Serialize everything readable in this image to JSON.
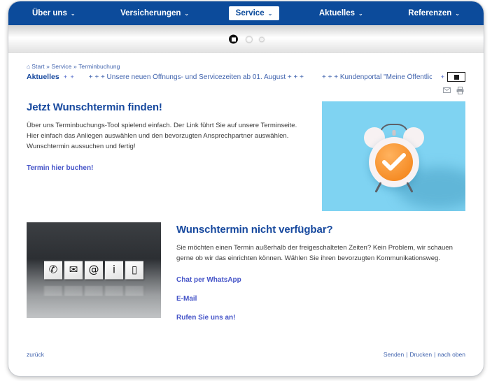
{
  "nav": {
    "items": [
      {
        "label": "Über uns",
        "active": false,
        "caret": "⌄"
      },
      {
        "label": "Versicherungen",
        "active": false,
        "caret": "⌄"
      },
      {
        "label": "Service",
        "active": true,
        "caret": "⌄"
      },
      {
        "label": "Aktuelles",
        "active": false,
        "caret": "⌄"
      },
      {
        "label": "Referenzen",
        "active": false,
        "caret": "⌄"
      }
    ]
  },
  "hero": {
    "slide_count": 3,
    "active_slide": 1
  },
  "breadcrumb": {
    "home_icon": "⌂",
    "text": "Start » Service » Terminbuchung"
  },
  "ticker": {
    "label": "Aktuelles",
    "plus": "+ +",
    "items": [
      "+ + + Unsere neuen Öffnungs- und Servicezeiten ab 01. August + + +",
      "+ + + Kundenportal \"Meine Öffentliche\" + + +"
    ],
    "trailing_plus": "+",
    "pause_control": "pause-button"
  },
  "tools": {
    "send_icon": "send-icon",
    "print_icon": "print-icon"
  },
  "section1": {
    "heading": "Jetzt Wunschtermin finden!",
    "body": "Über uns Terminbuchungs-Tool spielend einfach. Der Link führt Sie auf unsere Terminseite. Hier einfach das Anliegen auswählen und den bevorzugten Ansprechpartner auswählen. Wunschtermin aussuchen und fertig!",
    "link": "Termin hier buchen!",
    "image_alt": "alarm-clock-with-checkmark"
  },
  "section2": {
    "heading": "Wunschtermin nicht verfügbar?",
    "body": "Sie möchten einen Termin außerhalb der freigeschalteten Zeiten? Kein Problem, wir schauen gerne ob wir das einrichten können. Wählen Sie ihren bevorzugten Kommunikationsweg.",
    "links": [
      "Chat per WhatsApp",
      " E-Mail",
      "Rufen Sie uns an!"
    ],
    "image_alt": "contact-icon-cubes",
    "cube_glyphs": [
      "✆",
      "✉",
      "@",
      "i",
      "▯"
    ]
  },
  "footer": {
    "back": "zurück",
    "send": "Senden",
    "print": "Drucken",
    "top": "nach oben",
    "separator": "|"
  },
  "colors": {
    "nav_blue": "#0c4b9b",
    "heading_blue": "#16489e",
    "link_violet": "#4554c8",
    "breadcrumb_blue": "#3f62ad",
    "accent_orange": "#f58b24",
    "clock_bg_blue": "#7fd3f2"
  }
}
